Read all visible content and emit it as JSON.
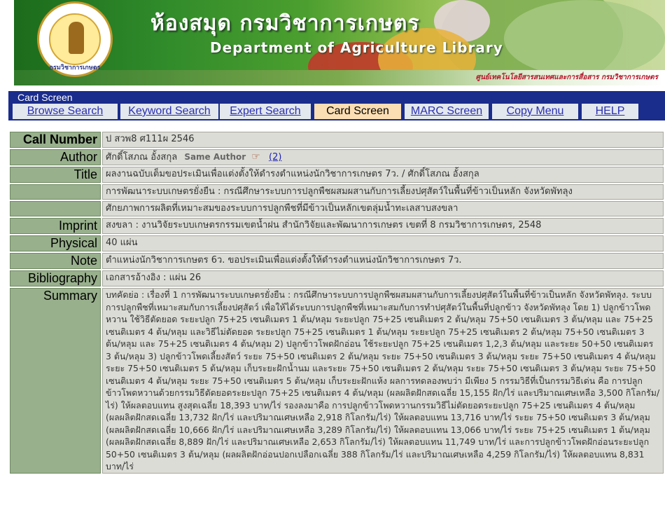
{
  "header": {
    "title_th": "ห้องสมุด กรมวิชาการเกษตร",
    "title_en": "Department of Agriculture Library",
    "seal_text": "กรมวิชาการเกษตร",
    "caption": "ศูนย์เทคโนโลยีสารสนเทศและการสื่อสาร กรมวิชาการเกษตร"
  },
  "screen_title": "Card Screen",
  "tabs": [
    {
      "label": "Browse Search",
      "active": false
    },
    {
      "label": "Keyword Search",
      "active": false
    },
    {
      "label": "Expert Search",
      "active": false
    },
    {
      "label": "Card Screen",
      "active": true
    },
    {
      "label": "MARC Screen",
      "active": false
    },
    {
      "label": "Copy Menu",
      "active": false
    },
    {
      "label": "HELP",
      "active": false
    }
  ],
  "record": {
    "call_number": {
      "label": "Call Number",
      "value": "ป สวพ8 ศ111ผ 2546"
    },
    "author": {
      "label": "Author",
      "value": "ศักดิ์โสภณ อั้งสกุล",
      "same_author": "Same Author",
      "count": "(2)"
    },
    "title": {
      "label": "Title",
      "value": "ผลงานฉบับเต็มขอประเมินเพื่อแต่งตั้งให้ดำรงตำแหน่งนักวิชาการเกษตร 7ว. / ศักดิ์โสภณ อั้งสกุล"
    },
    "title_line2": "การพัฒนาระบบเกษตรยั่งยืน : กรณีศึกษาระบบการปลูกพืชผสมผสานกับการเลี้ยงปศุสัตว์ในพื้นที่ข้าวเป็นหลัก จังหวัดพัทลุง",
    "title_line3": "ศักยภาพการผลิตที่เหมาะสมของระบบการปลูกพืชที่มีข้าวเป็นหลักเขตลุ่มน้ำทะเลสาบสงขลา",
    "imprint": {
      "label": "Imprint",
      "value": "สงขลา : งานวิจัยระบบเกษตรกรรมเขตน้ำฝน สำนักวิจัยและพัฒนาการเกษตร เขตที่ 8 กรมวิชาการเกษตร, 2548"
    },
    "physical": {
      "label": "Physical",
      "value": "40 แผ่น"
    },
    "note": {
      "label": "Note",
      "value": "ตำแหน่งนักวิชาการเกษตร 6ว. ขอประเมินเพื่อแต่งตั้งให้ดำรงตำแหน่งนักวิชาการเกษตร 7ว."
    },
    "bibliography": {
      "label": "Bibliography",
      "value": "เอกสารอ้างอิง : แผ่น 26"
    },
    "summary": {
      "label": "Summary",
      "value": "บทคัดย่อ : เรื่องที่ 1 การพัฒนาระบบเกษตรยั่งยืน : กรณีศึกษาระบบการปลูกพืชผสมผสานกับการเลี้ยงปศุสัตว์ในพื้นที่ข้าวเป็นหลัก จังหวัดพัทลุง. ระบบการปลูกพืชที่เหมาะสมกับการเลี้ยงปศุสัตว์ เพื่อให้ได้ระบบการปลูกพืชที่เหมาะสมกับการทำปศุสัตว์ในพื้นที่ปลูกข้าว จังหวัดพัทลุง โดย 1) ปลูกข้าวโพดหวาน ใช้วิธีตัดยอด ระยะปลูก 75+25 เซนติเมตร 1 ต้น/หลุม ระยะปลูก 75+25 เซนติเมตร 2 ต้น/หลุม 75+50 เซนติเมตร 3 ต้น/หลุม และ 75+25 เซนติเมตร 4 ต้น/หลุม และวิธีไม่ตัดยอด ระยะปลูก 75+25 เซนติเมตร 1 ต้น/หลุม ระยะปลูก 75+25 เซนติเมตร 2 ต้น/หลุม 75+50 เซนติเมตร 3 ต้น/หลุม และ 75+25 เซนติเมตร 4 ต้น/หลุม 2) ปลูกข้าวโพดฝักอ่อน ใช้ระยะปลูก 75+25 เซนติเมตร 1,2,3 ต้น/หลุม และระยะ 50+50 เซนติเมตร 3 ต้น/หลุม 3) ปลูกข้าวโพดเลี้ยงสัตว์ ระยะ 75+50 เซนติเมตร 2 ต้น/หลุม ระยะ 75+50 เซนติเมตร 3 ต้น/หลุม ระยะ 75+50 เซนติเมตร 4 ต้น/หลุม ระยะ 75+50 เซนติเมตร 5 ต้น/หลุม เก็บระยะฝักน้ำนม และระยะ 75+50 เซนติเมตร 2 ต้น/หลุม ระยะ 75+50 เซนติเมตร 3 ต้น/หลุม ระยะ 75+50 เซนติเมตร 4 ต้น/หลุม ระยะ 75+50 เซนติเมตร 5 ต้น/หลุม เก็บระยะฝักแห้ง ผลการทดลองพบว่า มีเพียง 5 กรรมวิธีที่เป็นกรรมวิธีเด่น คือ การปลูกข้าวโพดหวานด้วยกรรมวิธีตัดยอดระยะปลูก 75+25 เซนติเมตร 4 ต้น/หลุม (ผลผลิตฝักสดเฉลี่ย 15,155 ฝัก/ไร่ และปริมาณเศษเหลือ 3,500 กิโลกรัม/ไร่) ให้ผลตอบแทน สูงสุดเฉลี่ย 18,393 บาท/ไร่ รองลงมาคือ การปลูกข้าวโพดหวานกรรมวิธีไม่ตัดยอดระยะปลูก 75+25 เซนติเมตร 4 ต้น/หลุม (ผลผลิตฝักสดเฉลี่ย 13,732 ฝัก/ไร่ และปริมาณเศษเหลือ 2,918 กิโลกรัม/ไร่) ให้ผลตอบแทน 13,716 บาท/ไร่ ระยะ 75+50 เซนติเมตร 3 ต้น/หลุม (ผลผลิตฝักสดเฉลี่ย 10,666 ฝัก/ไร่ และปริมาณเศษเหลือ 3,289 กิโลกรัม/ไร่) ให้ผลตอบแทน 13,066 บาท/ไร่ ระยะ 75+25 เซนติเมตร 1 ต้น/หลุม (ผลผลิตฝักสดเฉลี่ย 8,889 ฝัก/ไร่ และปริมาณเศษเหลือ 2,653 กิโลกรัม/ไร่) ให้ผลตอบแทน 11,749 บาท/ไร่ และการปลูกข้าวโพดฝักอ่อนระยะปลูก 50+50 เซนติเมตร 3 ต้น/หลุม (ผลผลิตฝักอ่อนปอกเปลือกเฉลี่ย 388 กิโลกรัม/ไร่ และปริมาณเศษเหลือ 4,259 กิโลกรัม/ไร่) ให้ผลตอบแทน 8,831 บาท/ไร่"
    }
  }
}
